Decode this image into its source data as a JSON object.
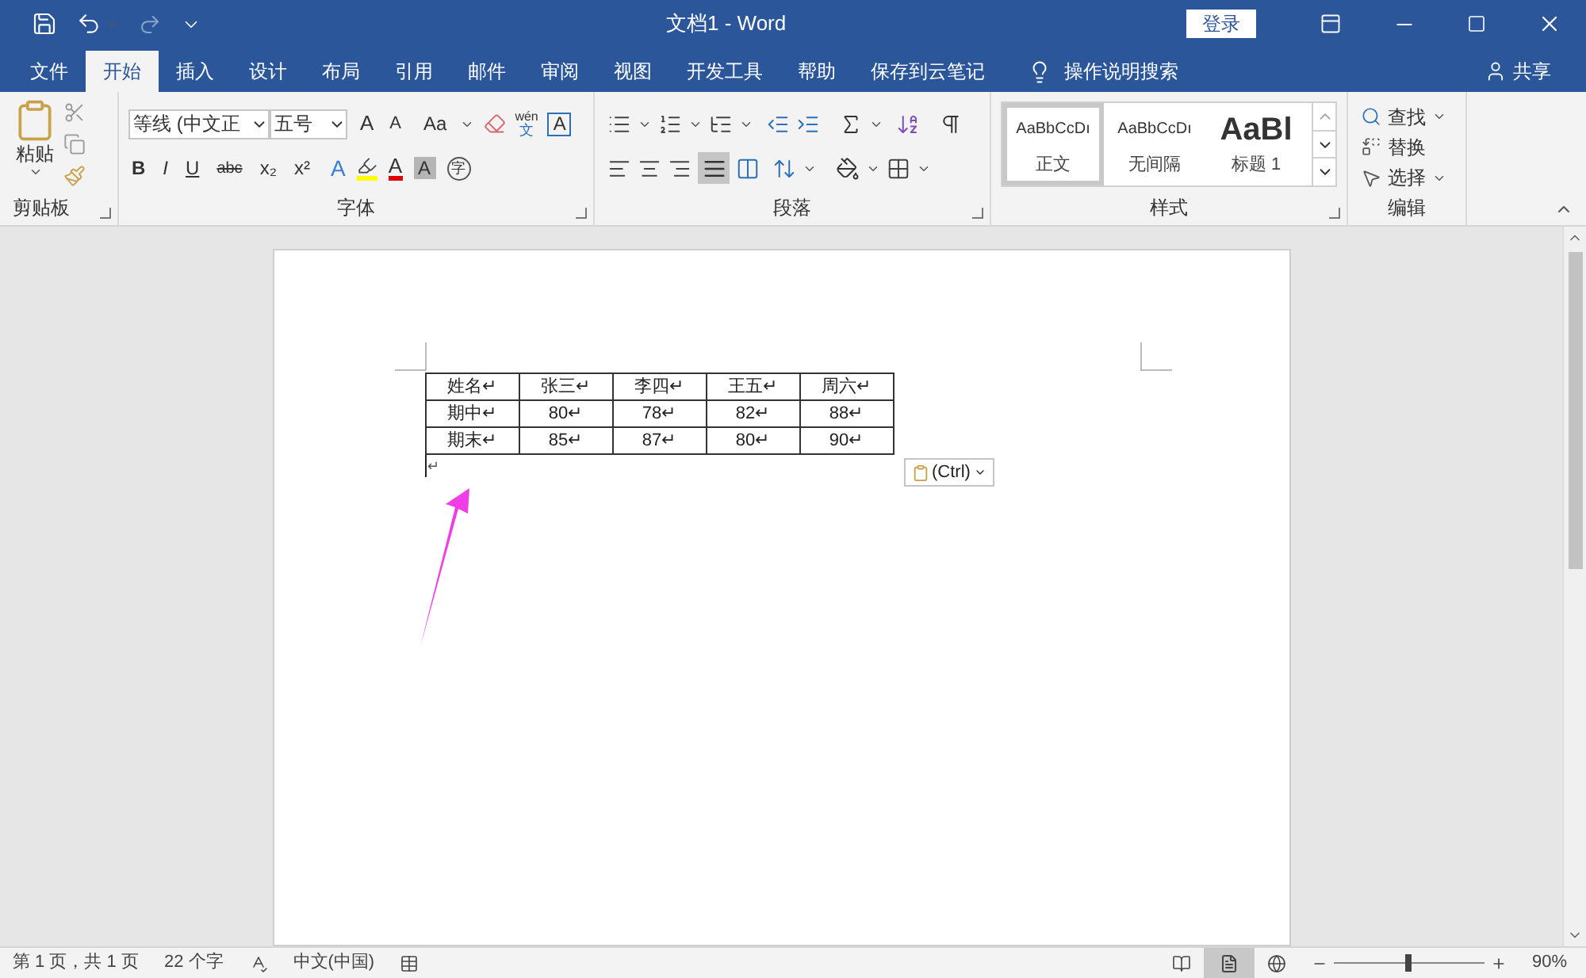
{
  "window": {
    "title": "文档1 - Word",
    "login_button": "登录"
  },
  "tabs": [
    {
      "label": "文件",
      "selected": false
    },
    {
      "label": "开始",
      "selected": true
    },
    {
      "label": "插入",
      "selected": false
    },
    {
      "label": "设计",
      "selected": false
    },
    {
      "label": "布局",
      "selected": false
    },
    {
      "label": "引用",
      "selected": false
    },
    {
      "label": "邮件",
      "selected": false
    },
    {
      "label": "审阅",
      "selected": false
    },
    {
      "label": "视图",
      "selected": false
    },
    {
      "label": "开发工具",
      "selected": false
    },
    {
      "label": "帮助",
      "selected": false
    },
    {
      "label": "保存到云笔记",
      "selected": false
    }
  ],
  "tell_me": "操作说明搜索",
  "share": "共享",
  "ribbon": {
    "clipboard": {
      "paste": "粘贴",
      "label": "剪贴板"
    },
    "font": {
      "font_name": "等线 (中文正",
      "font_size": "五号",
      "grow": "A",
      "shrink": "A",
      "change_case": "Aa",
      "phonetic": "wén",
      "phonetic_char": "文",
      "border_char": "A",
      "format_buttons": [
        "B",
        "I",
        "U",
        "abc",
        "x₂",
        "x²"
      ],
      "effects": "A",
      "font_color": "A",
      "shading": "A",
      "enclosed": "字",
      "label": "字体"
    },
    "paragraph": {
      "label": "段落"
    },
    "styles": {
      "items": [
        {
          "preview": "AaBbCcDı",
          "name": "正文",
          "kind": "paragraph",
          "selected": true
        },
        {
          "preview": "AaBbCcDı",
          "name": "无间隔",
          "kind": "paragraph",
          "selected": false
        },
        {
          "preview": "AaBl",
          "name": "标题 1",
          "kind": "heading",
          "selected": false
        }
      ],
      "label": "样式"
    },
    "editing": {
      "items": [
        {
          "label": "查找",
          "kind": "find"
        },
        {
          "label": "替换",
          "kind": "replace"
        },
        {
          "label": "选择",
          "kind": "select"
        }
      ],
      "label": "编辑"
    }
  },
  "table": {
    "rows": [
      [
        "姓名↵",
        "张三↵",
        "李四↵",
        "王五↵",
        "周六↵"
      ],
      [
        "期中↵",
        "80↵",
        "78↵",
        "82↵",
        "88↵"
      ],
      [
        "期末↵",
        "85↵",
        "87↵",
        "80↵",
        "90↵"
      ]
    ],
    "after_mark": "↵"
  },
  "paste_options": "(Ctrl)",
  "status_bar": {
    "page": "第 1 页，共 1 页",
    "words": "22 个字",
    "language": "中文(中国)",
    "zoom": "90%",
    "level": 0.5
  }
}
